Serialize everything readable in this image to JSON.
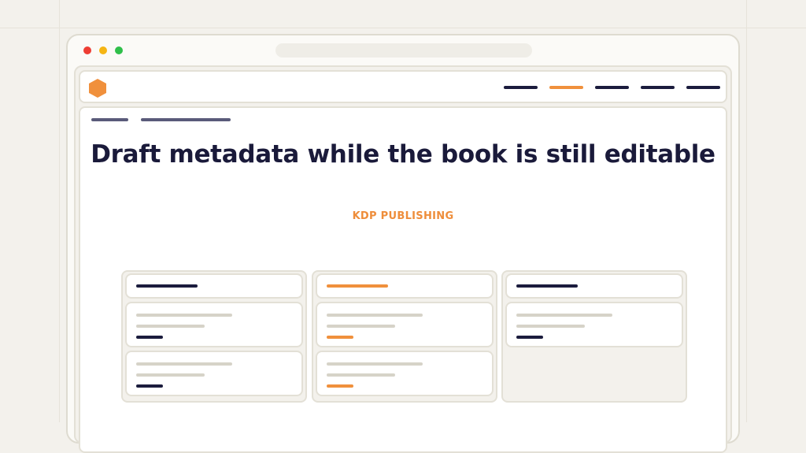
{
  "browser": {
    "window_controls": [
      "close",
      "minimize",
      "maximize"
    ],
    "address_bar": ""
  },
  "header": {
    "logo_icon": "hexagon-logo-icon",
    "nav_items": [
      {
        "id": "nav-item-1",
        "active": false
      },
      {
        "id": "nav-item-2",
        "active": true
      },
      {
        "id": "nav-item-3",
        "active": false
      },
      {
        "id": "nav-item-4",
        "active": false
      },
      {
        "id": "nav-item-5",
        "active": false
      }
    ]
  },
  "hero": {
    "title": "Draft metadata while the book is still editable",
    "kicker": "KDP PUBLISHING"
  },
  "board": {
    "columns": [
      {
        "accent": false,
        "cards": [
          {
            "accent": false
          },
          {
            "accent": false
          }
        ]
      },
      {
        "accent": true,
        "cards": [
          {
            "accent": true
          },
          {
            "accent": true
          }
        ]
      },
      {
        "accent": false,
        "cards": [
          {
            "accent": false
          }
        ]
      }
    ]
  },
  "colors": {
    "accent": "#f0903c",
    "navy": "#1b1c3d",
    "background": "#f3f1ec",
    "border": "#e3e0d6"
  }
}
